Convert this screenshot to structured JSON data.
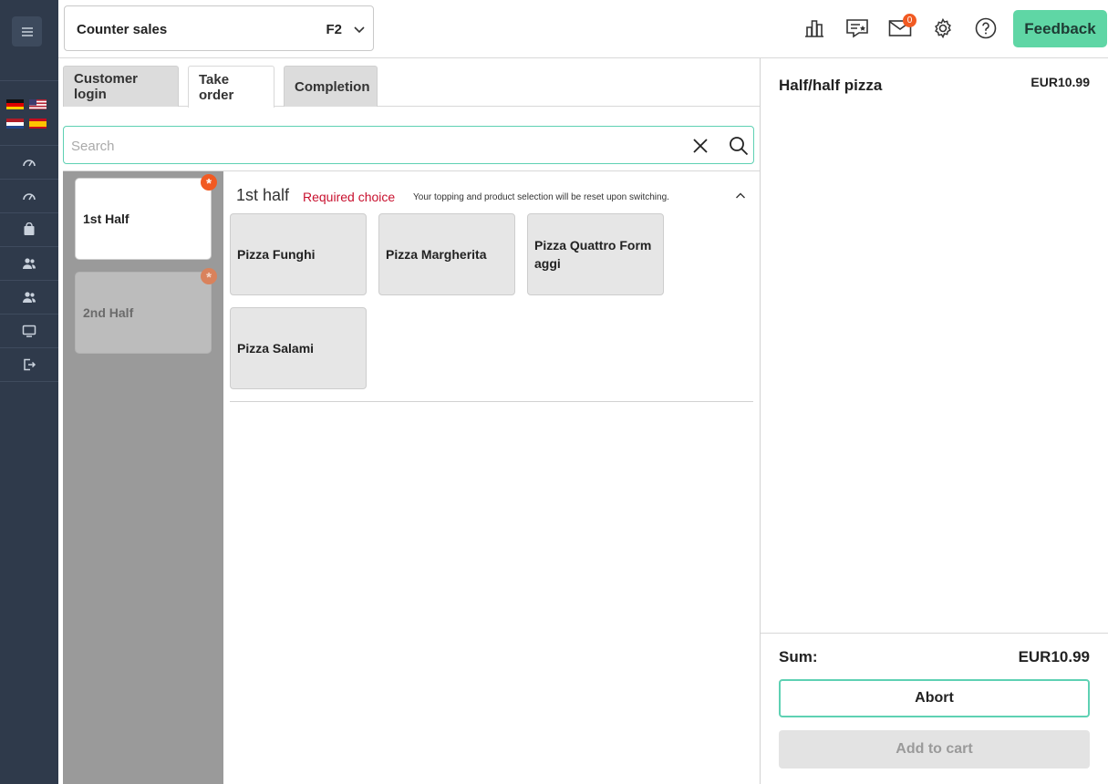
{
  "store": {
    "name": "Counter sales",
    "shortcut": "F2"
  },
  "topbar": {
    "mail_count": "0",
    "feedback_label": "Feedback"
  },
  "tabs": [
    {
      "label": "Customer login",
      "active": false
    },
    {
      "label": "Take order",
      "active": true
    },
    {
      "label": "Completion",
      "active": false
    }
  ],
  "search": {
    "placeholder": "Search",
    "value": ""
  },
  "halves": [
    {
      "label": "1st Half",
      "selected": true,
      "required_mark": "*"
    },
    {
      "label": "2nd Half",
      "selected": false,
      "required_mark": "*"
    }
  ],
  "section": {
    "title": "1st half",
    "required_label": "Required choice",
    "note": "Your topping and product selection will be reset upon switching."
  },
  "products": [
    {
      "name": "Pizza Funghi"
    },
    {
      "name": "Pizza Margherita"
    },
    {
      "name": "Pizza Quattro Formaggi"
    },
    {
      "name": "Pizza Salami"
    }
  ],
  "summary": {
    "item_name": "Half/half pizza",
    "item_price": "EUR10.99",
    "sum_label": "Sum:",
    "sum_value": "EUR10.99",
    "abort_label": "Abort",
    "add_to_cart_label": "Add to cart"
  },
  "rail_icons": [
    "dashboard-icon",
    "dashboard-icon",
    "shopping-bag-icon",
    "users-icon",
    "users-icon",
    "monitor-icon",
    "logout-icon"
  ],
  "colors": {
    "accent": "#5fd6a5",
    "required": "#c8102e",
    "badge": "#f15a22",
    "rail": "#2f3a4b"
  }
}
